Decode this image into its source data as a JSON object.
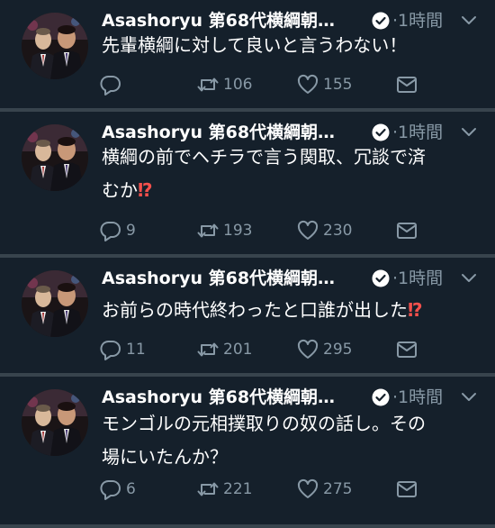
{
  "author": {
    "name": "Asashoryu 第68代横綱朝…",
    "time": "·1時間"
  },
  "tweets": [
    {
      "text": "先輩横綱に対して良いと言うわない！",
      "alarm": "",
      "text2": "",
      "replies": "",
      "retweets": "106",
      "likes": "155"
    },
    {
      "text": "横綱の前でヘチラで言う関取、冗談で済",
      "alarm": "",
      "text2": "むか",
      "alarm2": "⁉",
      "replies": "9",
      "retweets": "193",
      "likes": "230"
    },
    {
      "text": "お前らの時代終わったと口誰が出した",
      "alarm": "⁉",
      "text2": "",
      "replies": "11",
      "retweets": "201",
      "likes": "295"
    },
    {
      "text": "モンゴルの元相撲取りの奴の話し。その",
      "alarm": "",
      "text2": "場にいたんか？",
      "replies": "6",
      "retweets": "221",
      "likes": "275"
    }
  ],
  "colors": {
    "background": "#15202b",
    "divider": "#38444d",
    "muted": "#8899a6",
    "alarm": "#f4504c"
  },
  "icons": [
    "verified-badge-icon",
    "chevron-down-icon",
    "reply-icon",
    "retweet-icon",
    "like-icon",
    "direct-message-icon"
  ]
}
